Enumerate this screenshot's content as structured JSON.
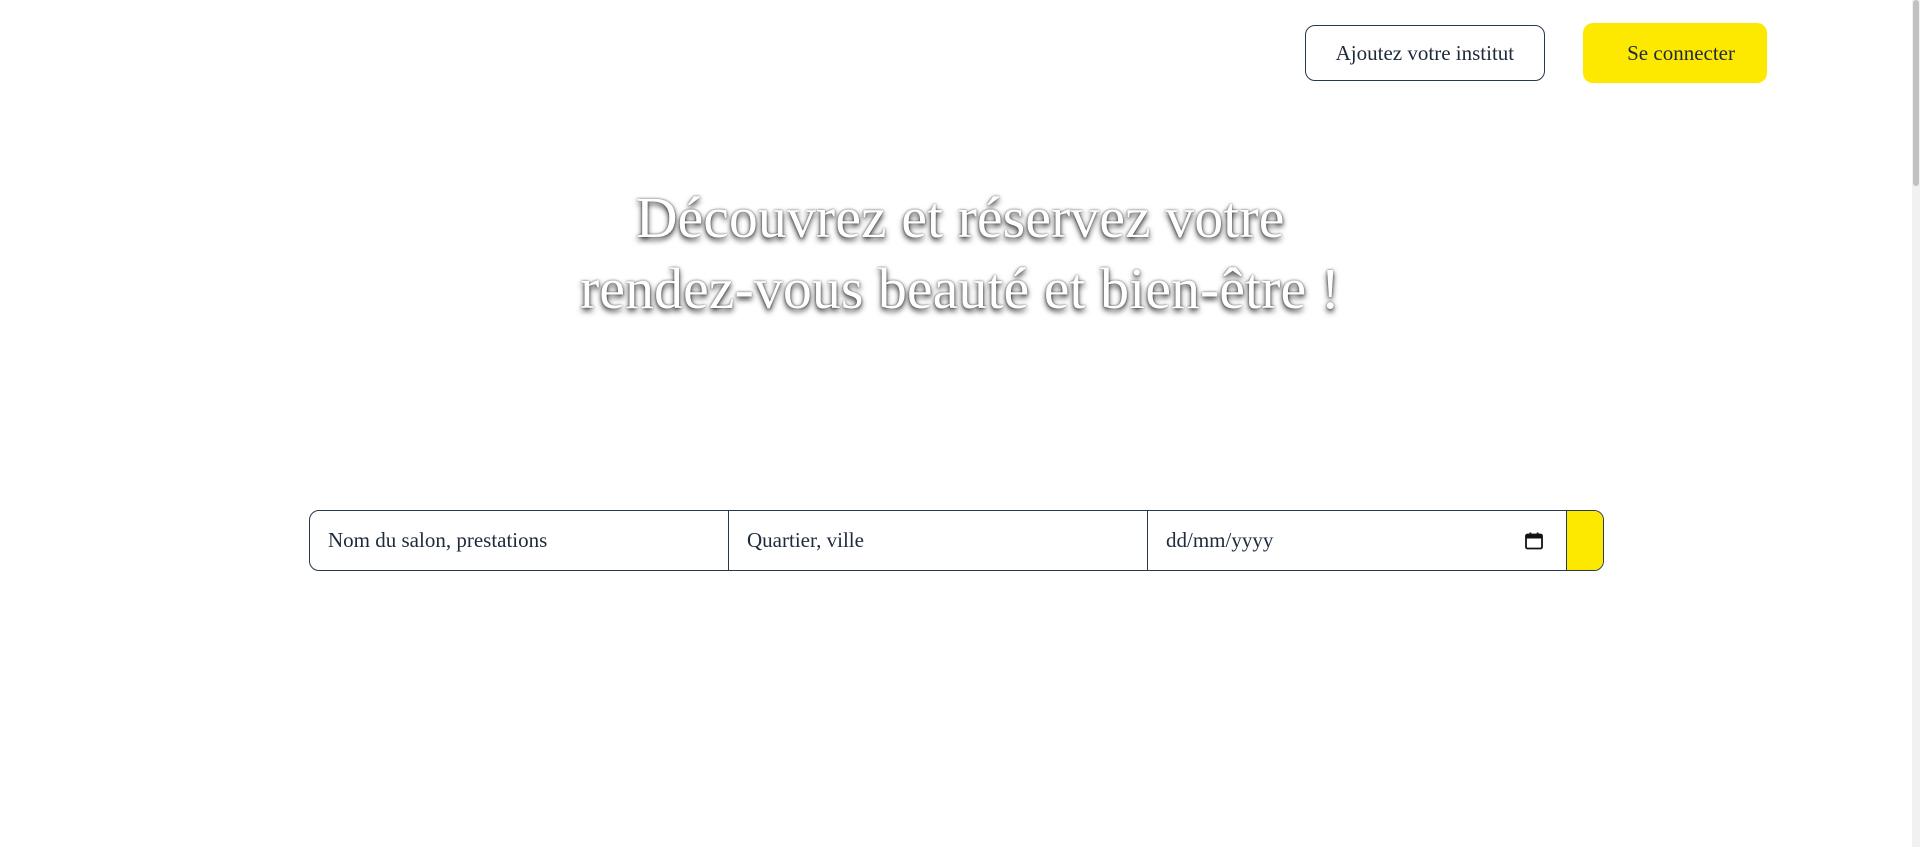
{
  "header": {
    "add_institute_label": "Ajoutez votre institut",
    "login_label": "Se connecter"
  },
  "hero": {
    "title_line1": "Découvrez et réservez votre",
    "title_line2": "rendez-vous beauté et bien-être !"
  },
  "search": {
    "salon_placeholder": "Nom du salon, prestations",
    "location_placeholder": "Quartier, ville",
    "date_placeholder": "dd/mm/yyyy",
    "date_icon": "calendar-icon"
  },
  "colors": {
    "accent": "#fde900",
    "border": "#27384f",
    "text": "#1e2a3b",
    "background": "#ffffff"
  }
}
